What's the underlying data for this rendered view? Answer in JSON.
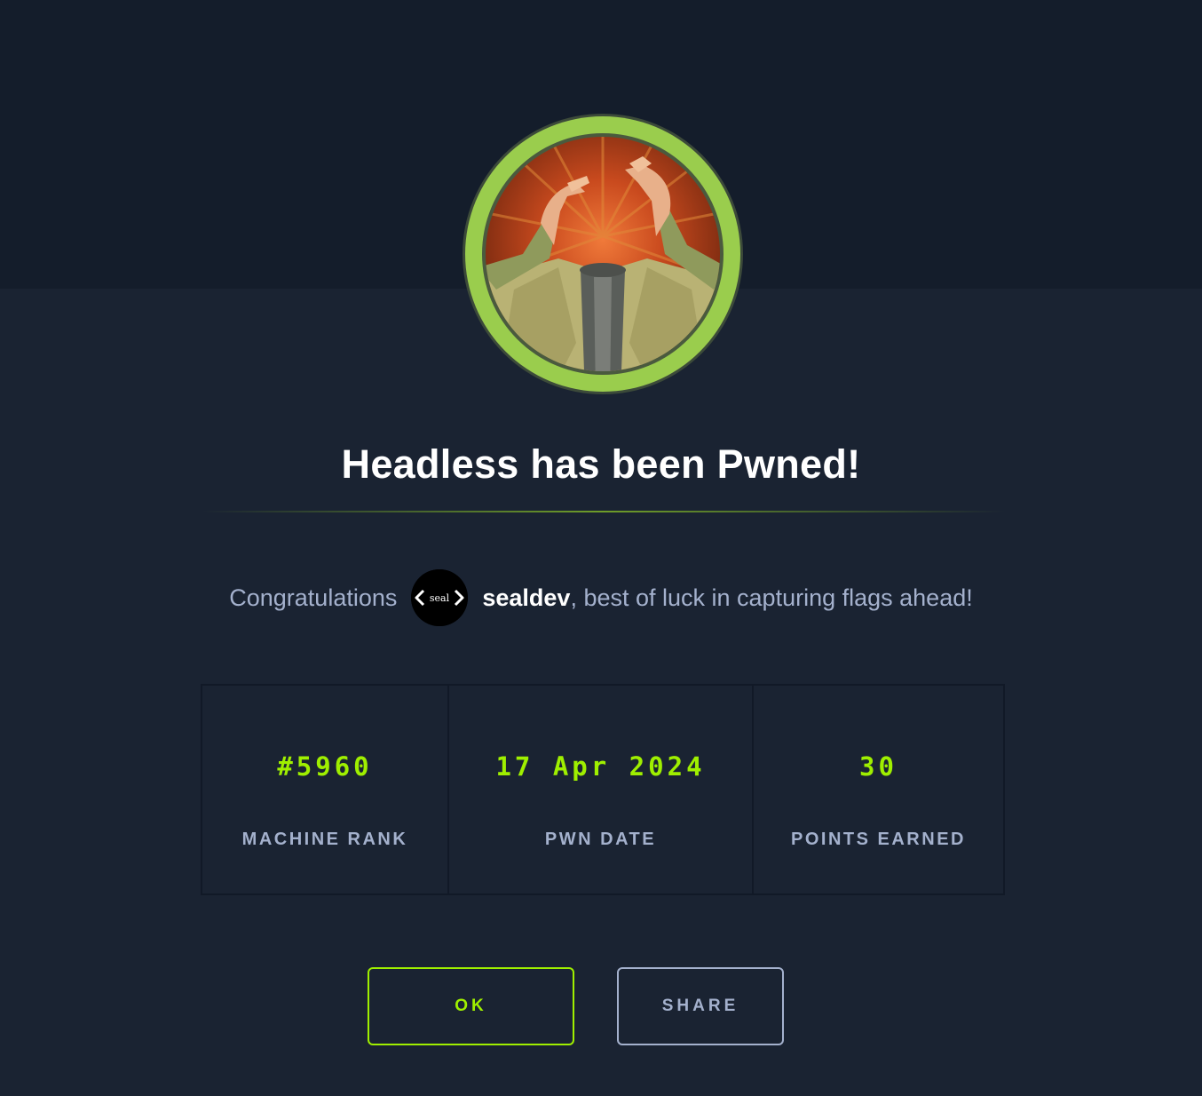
{
  "machine": {
    "name": "Headless",
    "title": "Headless has been Pwned!",
    "avatar_icon": "headless-machine-icon",
    "ring_color": "#9fef00"
  },
  "congrats": {
    "prefix": "Congratulations",
    "user_avatar_text": "seal",
    "username": "sealdev",
    "suffix": ", best of luck in capturing flags ahead!"
  },
  "stats": [
    {
      "value": "#5960",
      "label": "MACHINE RANK"
    },
    {
      "value": "17 Apr 2024",
      "label": "PWN DATE"
    },
    {
      "value": "30",
      "label": "POINTS EARNED"
    }
  ],
  "buttons": {
    "ok": "OK",
    "share": "SHARE"
  },
  "colors": {
    "accent": "#9fef00",
    "background": "#1a2332",
    "header_background": "#141d2b",
    "muted_text": "#a4b1cd"
  }
}
